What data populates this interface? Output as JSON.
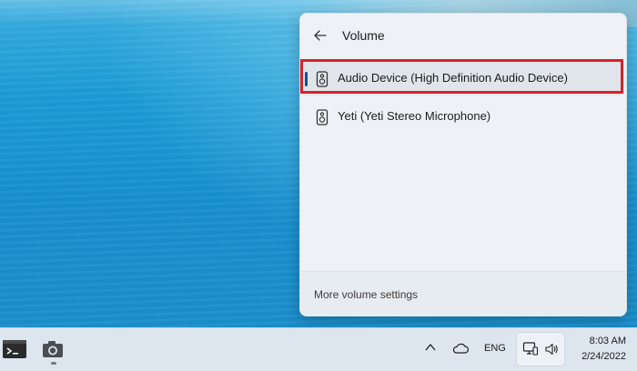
{
  "flyout": {
    "title": "Volume",
    "devices": [
      {
        "label": "Audio Device (High Definition Audio Device)",
        "selected": true
      },
      {
        "label": "Yeti (Yeti Stereo Microphone)",
        "selected": false
      }
    ],
    "footer_link": "More volume settings"
  },
  "taskbar": {
    "apps": [
      "terminal-icon",
      "camera-icon"
    ],
    "tray": {
      "language": "ENG",
      "time": "8:03 AM",
      "date": "2/24/2022"
    }
  },
  "colors": {
    "highlight": "#d8232a",
    "selection_bar": "#0b4fa8"
  }
}
